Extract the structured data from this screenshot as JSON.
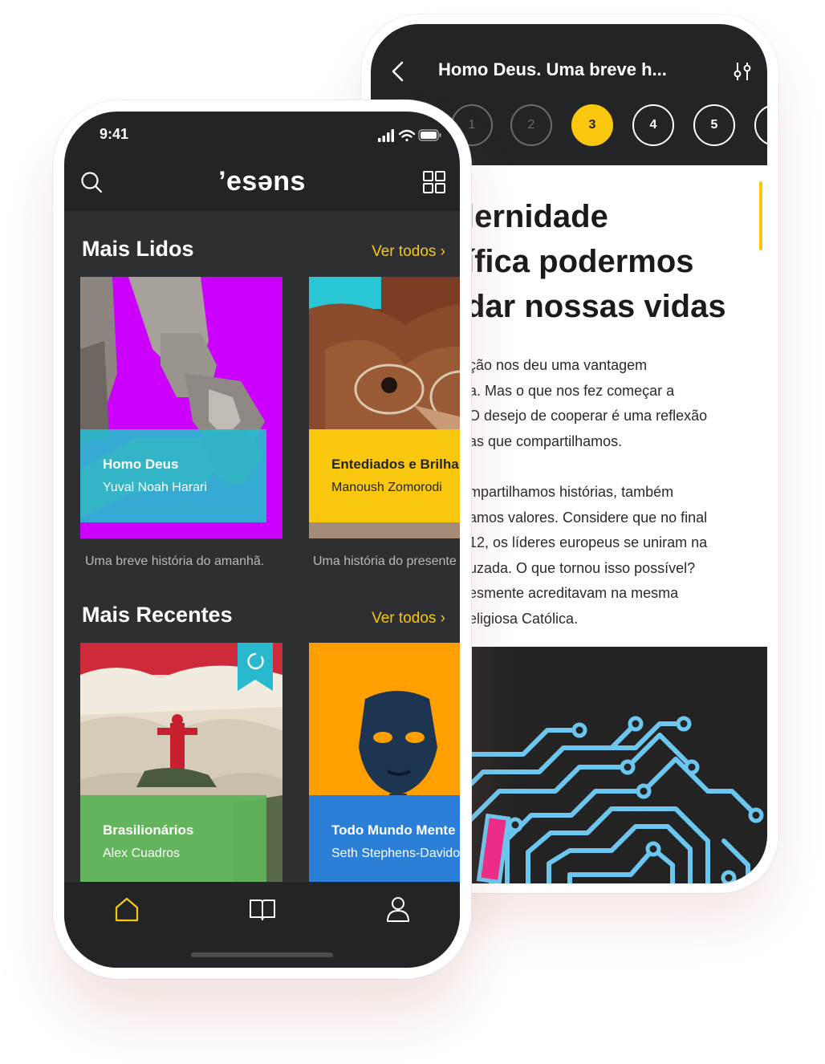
{
  "reader": {
    "title": "Homo Deus. Uma breve h...",
    "steps": [
      "",
      "1",
      "2",
      "3",
      "4",
      "5",
      ""
    ],
    "active_step": "3",
    "chapter_title": "lernidade\nífica podermos\ndar nossas vidas",
    "paragraph1": "ção nos deu uma vantagem\na. Mas o que nos fez começar a\nO desejo de cooperar é uma reflexão\nas que compartilhamos.",
    "paragraph2": "mpartilhamos histórias, também\namos valores. Considere que no final\n12, os líderes europeus se uniram na\nuzada. O que tornou isso possível?\nesmente acreditavam na mesma\neligiosa Católica."
  },
  "status": {
    "time": "9:41"
  },
  "app": {
    "logo": "’esəns"
  },
  "sections": [
    {
      "title": "Mais Lidos",
      "see_all": "Ver todos ›",
      "books": [
        {
          "title": "Homo Deus",
          "author": "Yuval Noah Harari",
          "subtitle": "Uma breve história do amanhã."
        },
        {
          "title": "Entediados e Brilhantes",
          "author": "Manoush Zomorodi",
          "subtitle": "Uma história do presente"
        }
      ]
    },
    {
      "title": "Mais Recentes",
      "see_all": "Ver todos ›",
      "books": [
        {
          "title": "Brasilionários",
          "author": "Alex Cuadros"
        },
        {
          "title": "Todo Mundo Mente",
          "author": "Seth Stephens-Davidowitz"
        }
      ]
    }
  ],
  "colors": {
    "accent": "#f9c80e",
    "dark": "#232427",
    "content_bg": "#2e2f33",
    "teal": "#29b9cf",
    "magenta": "#cc00ff",
    "green": "#5fb35a",
    "blue": "#2c7fd6",
    "orange": "#ffa000"
  },
  "icons": {
    "tabs": [
      "home-icon",
      "book-icon",
      "profile-icon"
    ]
  }
}
